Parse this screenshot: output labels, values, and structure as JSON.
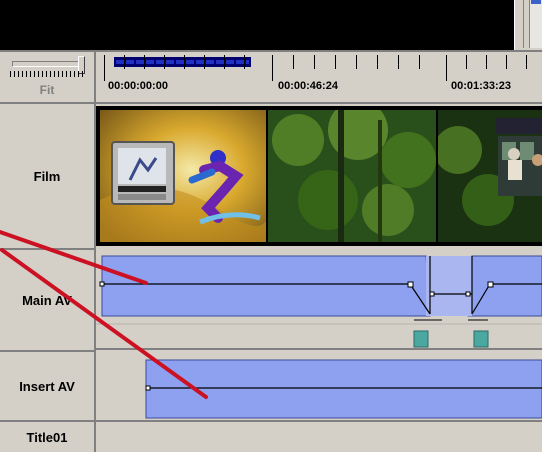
{
  "ruler": {
    "zoom_label": "Fit",
    "timecodes": [
      "00:00:00:00",
      "00:00:46:24",
      "00:01:33:23"
    ]
  },
  "tracks": [
    {
      "label": "Film"
    },
    {
      "label": "Main AV"
    },
    {
      "label": "Insert AV"
    },
    {
      "label": "Title01"
    }
  ],
  "colors": {
    "clip_fill": "#8da1f0",
    "annotation": "#cc1122",
    "transition_marker": "#4aa8a0",
    "ruler_range": "#000070"
  },
  "icons": [
    "zoom-slider",
    "transition-marker"
  ]
}
